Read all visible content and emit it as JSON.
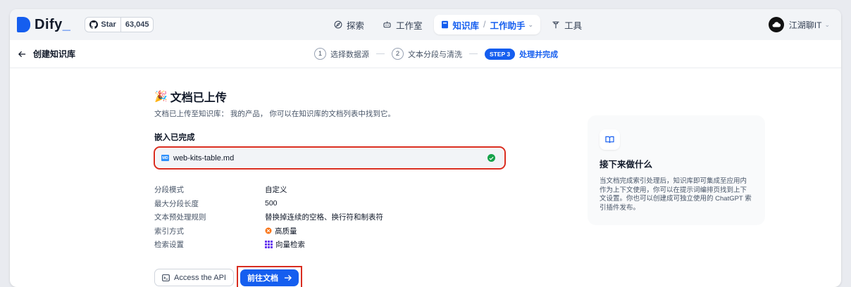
{
  "header": {
    "logo_text": "Dify",
    "github_star_label": "Star",
    "github_star_count": "63,045",
    "nav": [
      {
        "label": "探索"
      },
      {
        "label": "工作室"
      },
      {
        "label": "知识库",
        "sub": "工作助手"
      },
      {
        "label": "工具"
      }
    ],
    "user_name": "江湖聊IT"
  },
  "subheader": {
    "back_label": "创建知识库",
    "steps": [
      {
        "num": "1",
        "label": "选择数据源"
      },
      {
        "num": "2",
        "label": "文本分段与清洗"
      },
      {
        "badge": "STEP 3",
        "label": "处理并完成"
      }
    ]
  },
  "main": {
    "title_emoji": "🎉",
    "title": "文档已上传",
    "subtitle": "文档已上传至知识库： 我的产品， 你可以在知识库的文档列表中找到它。",
    "embed_label": "嵌入已完成",
    "file_icon": "MD",
    "file_name": "web-kits-table.md",
    "info": [
      {
        "label": "分段模式",
        "value": "自定义"
      },
      {
        "label": "最大分段长度",
        "value": "500"
      },
      {
        "label": "文本预处理规则",
        "value": "替换掉连续的空格、换行符和制表符"
      },
      {
        "label": "索引方式",
        "value": "高质量"
      },
      {
        "label": "检索设置",
        "value": "向量检索"
      }
    ],
    "api_button": "Access the API",
    "doc_button": "前往文档"
  },
  "side": {
    "title": "接下来做什么",
    "text": "当文档完成索引处理后，知识库即可集成至应用内作为上下文使用，你可以在提示词编排页找到上下文设置。你也可以创建成可独立使用的 ChatGPT 索引插件发布。"
  },
  "colors": {
    "accent": "#155eef",
    "highlight": "#d92d20",
    "success": "#16a34a"
  }
}
